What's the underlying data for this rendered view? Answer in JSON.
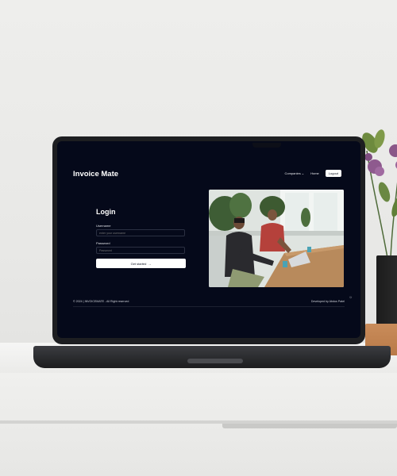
{
  "app": {
    "brand": "Invoice Mate"
  },
  "nav": {
    "items": [
      {
        "label": "Companies",
        "has_dropdown": true
      },
      {
        "label": "Home",
        "has_dropdown": false
      }
    ],
    "logout_label": "Logout"
  },
  "login": {
    "title": "Login",
    "username_label": "Username",
    "username_placeholder": "enter your username",
    "password_label": "Password",
    "password_placeholder": "Password",
    "submit_label": "Get started",
    "submit_icon": "arrow-right-icon"
  },
  "footer": {
    "copyright": "© 2024 | INVOICEMATE - All Right reserved",
    "developer": "Developed by Abdus Patel",
    "theme_icon": "theme-toggle-icon"
  },
  "colors": {
    "screen_bg": "#05091a",
    "text_primary": "#ffffff",
    "button_bg": "#ffffff",
    "input_border": "#2b3042"
  }
}
